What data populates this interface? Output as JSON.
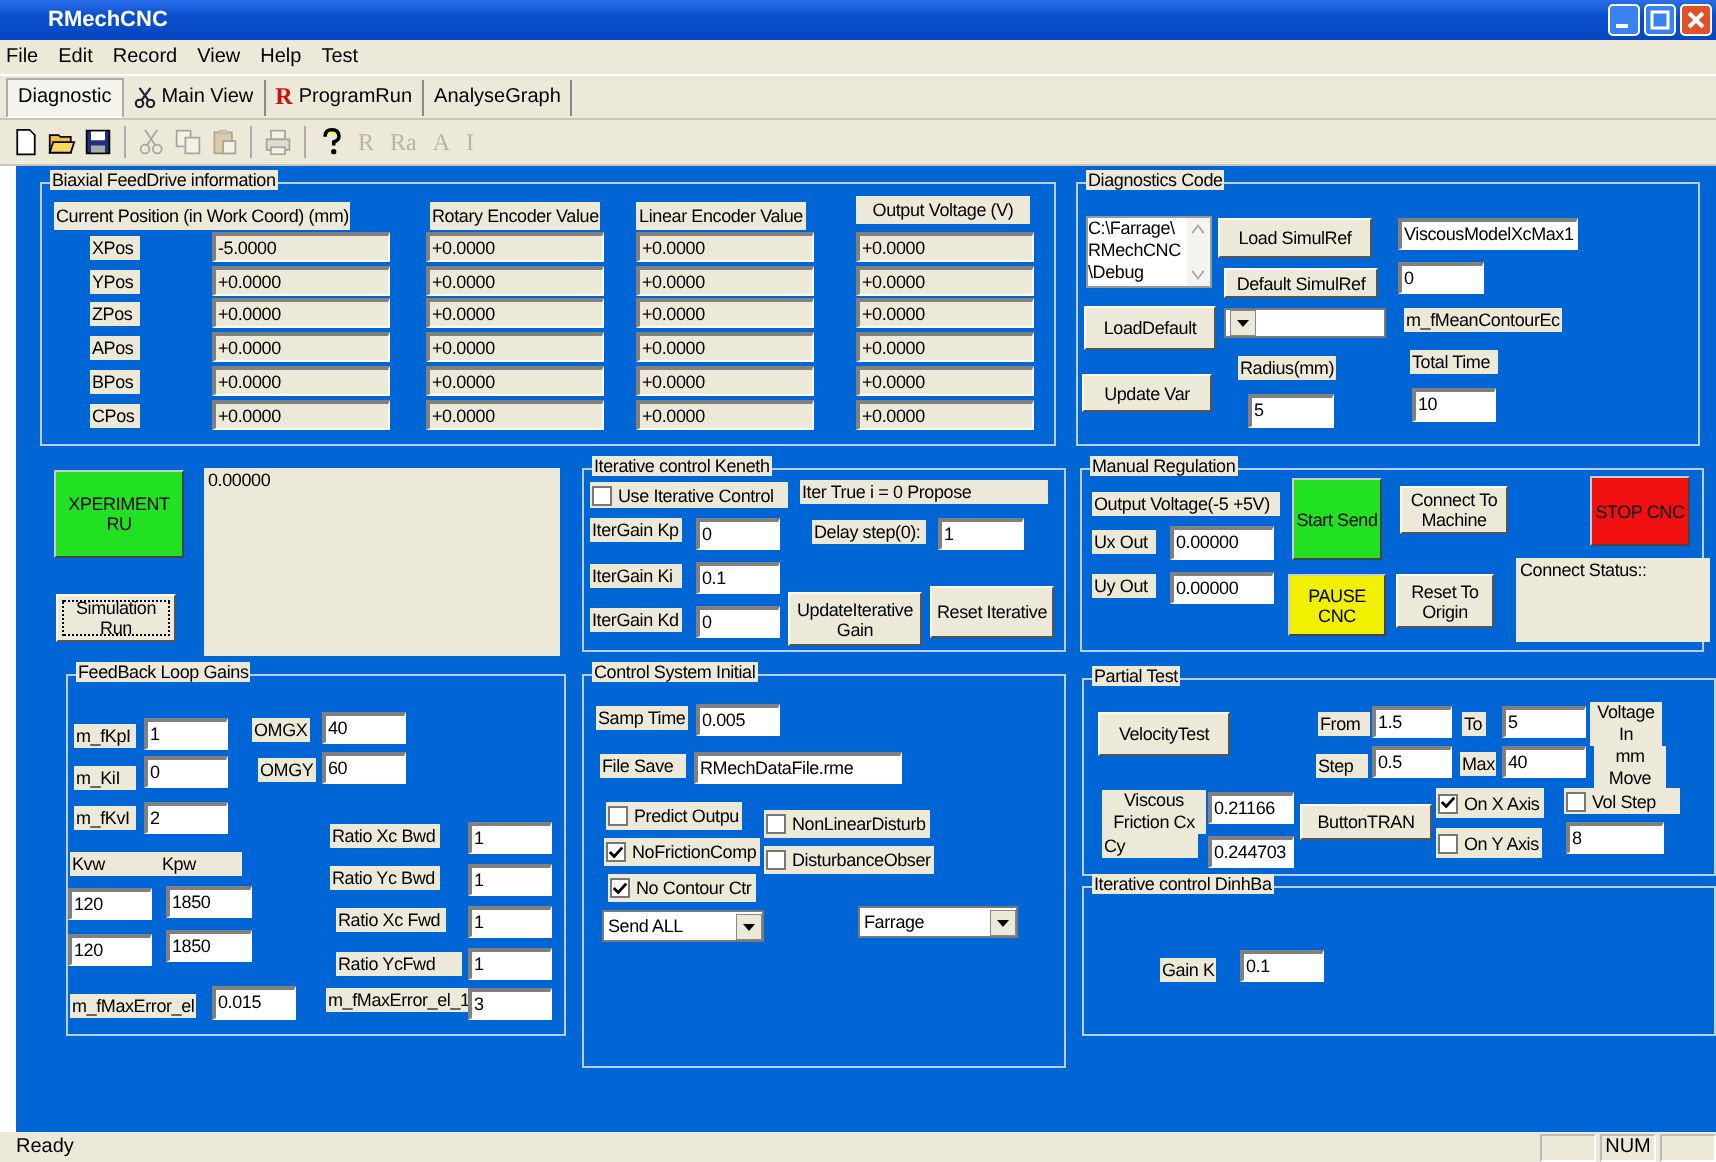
{
  "window": {
    "title": "RMechCNC"
  },
  "menu": [
    "File",
    "Edit",
    "Record",
    "View",
    "Help",
    "Test"
  ],
  "tabs": [
    {
      "label": "Diagnostic",
      "selected": true
    },
    {
      "label": "Main View",
      "selected": false,
      "kind": "scissors"
    },
    {
      "label": "ProgramRun",
      "selected": false,
      "prefix": "R"
    },
    {
      "label": "AnalyseGraph",
      "selected": false
    }
  ],
  "toolbar": [
    {
      "kind": "new",
      "disabled": false
    },
    {
      "kind": "open",
      "disabled": false
    },
    {
      "kind": "save",
      "disabled": false
    },
    {
      "kind": "separator"
    },
    {
      "kind": "cut",
      "disabled": true
    },
    {
      "kind": "copy",
      "disabled": true
    },
    {
      "kind": "paste",
      "disabled": true
    },
    {
      "kind": "separator"
    },
    {
      "kind": "print",
      "disabled": true
    },
    {
      "kind": "separator"
    },
    {
      "kind": "help",
      "disabled": false
    },
    {
      "kind": "text",
      "label": "R",
      "disabled": true
    },
    {
      "kind": "text",
      "label": "Ra",
      "disabled": true
    },
    {
      "kind": "text",
      "label": "A",
      "disabled": true
    },
    {
      "kind": "text",
      "label": "I",
      "disabled": true
    }
  ],
  "feed_drive": {
    "title": "Biaxial FeedDrive information",
    "columns": [
      "Current Position (in Work Coord) (mm)",
      "Rotary Encoder Value",
      "Linear Encoder Value",
      "Output Voltage (V)"
    ],
    "rows": [
      {
        "label": "XPos",
        "values": [
          "-5.0000",
          "+0.0000",
          "+0.0000",
          "+0.0000"
        ]
      },
      {
        "label": "YPos",
        "values": [
          "+0.0000",
          "+0.0000",
          "+0.0000",
          "+0.0000"
        ]
      },
      {
        "label": "ZPos",
        "values": [
          "+0.0000",
          "+0.0000",
          "+0.0000",
          "+0.0000"
        ]
      },
      {
        "label": "APos",
        "values": [
          "+0.0000",
          "+0.0000",
          "+0.0000",
          "+0.0000"
        ]
      },
      {
        "label": "BPos",
        "values": [
          "+0.0000",
          "+0.0000",
          "+0.0000",
          "+0.0000"
        ]
      },
      {
        "label": "CPos",
        "values": [
          "+0.0000",
          "+0.0000",
          "+0.0000",
          "+0.0000"
        ]
      }
    ]
  },
  "groups": [
    {
      "title": "Diagnostics Code",
      "controls": [
        {
          "kind": "listbox",
          "lines": [
            "C:\\Farrage\\",
            "RMechCNC",
            "\\Debug"
          ]
        },
        {
          "kind": "button",
          "text": "Load SimulRef"
        },
        {
          "kind": "field",
          "value": "ViscousModelXcMax1"
        },
        {
          "kind": "button",
          "text": "Default SimulRef"
        },
        {
          "kind": "field",
          "value": "0"
        },
        {
          "kind": "button",
          "text": "LoadDefault"
        },
        {
          "kind": "combo"
        },
        {
          "kind": "label",
          "text": "m_fMeanContourEc"
        },
        {
          "kind": "label",
          "text": "Radius(mm)"
        },
        {
          "kind": "label",
          "text": "Total Time"
        },
        {
          "kind": "button",
          "text": "Update Var"
        },
        {
          "kind": "field",
          "value": "5"
        },
        {
          "kind": "field",
          "value": "10"
        }
      ]
    },
    {
      "title": "Iterative control Keneth",
      "controls": [
        {
          "kind": "checkbox",
          "text": "Use Iterative Control",
          "checked": false
        },
        {
          "kind": "label",
          "text": "Iter True  i = 0   Propose"
        },
        {
          "kind": "label",
          "text": "IterGain Kp"
        },
        {
          "kind": "field",
          "value": "0"
        },
        {
          "kind": "label",
          "text": "Delay step(0):"
        },
        {
          "kind": "field",
          "value": "1"
        },
        {
          "kind": "label",
          "text": "IterGain Ki"
        },
        {
          "kind": "field",
          "value": "0.1"
        },
        {
          "kind": "label",
          "text": "IterGain Kd"
        },
        {
          "kind": "field",
          "value": "0"
        },
        {
          "kind": "button",
          "text": "UpdateIterative Gain"
        },
        {
          "kind": "button",
          "text": "Reset Iterative"
        }
      ]
    },
    {
      "title": "Manual Regulation",
      "controls": [
        {
          "kind": "label",
          "text": "Output Voltage(-5 +5V)"
        },
        {
          "kind": "label",
          "text": "Ux Out"
        },
        {
          "kind": "field",
          "value": "0.00000"
        },
        {
          "kind": "label",
          "text": "Uy Out"
        },
        {
          "kind": "field",
          "value": "0.00000"
        },
        {
          "kind": "button",
          "text": "Start Send",
          "color": "#22e022"
        },
        {
          "kind": "button",
          "text": "PAUSE CNC",
          "color": "#f0f000"
        },
        {
          "kind": "button",
          "text": "Connect To Machine"
        },
        {
          "kind": "button",
          "text": "Reset To Origin"
        },
        {
          "kind": "button",
          "text": "STOP CNC",
          "color": "#f01010"
        },
        {
          "kind": "static",
          "text": "Connect Status::"
        }
      ]
    },
    {
      "title": "FeedBack Loop Gains",
      "controls": [
        {
          "kind": "label",
          "text": "m_fKpI"
        },
        {
          "kind": "field",
          "value": "1"
        },
        {
          "kind": "label",
          "text": "OMGX"
        },
        {
          "kind": "field",
          "value": "40"
        },
        {
          "kind": "label",
          "text": "m_KiI"
        },
        {
          "kind": "field",
          "value": "0"
        },
        {
          "kind": "label",
          "text": "OMGY"
        },
        {
          "kind": "field",
          "value": "60"
        },
        {
          "kind": "label",
          "text": "m_fKvI"
        },
        {
          "kind": "field",
          "value": "2"
        },
        {
          "kind": "label",
          "text": "Ratio Xc Bwd"
        },
        {
          "kind": "field",
          "value": "1"
        },
        {
          "kind": "label",
          "text": "Kvw"
        },
        {
          "kind": "label",
          "text": "Kpw"
        },
        {
          "kind": "field",
          "value": "120"
        },
        {
          "kind": "field",
          "value": "1850"
        },
        {
          "kind": "label",
          "text": "Ratio Yc Bwd"
        },
        {
          "kind": "field",
          "value": "1"
        },
        {
          "kind": "label",
          "text": "Ratio Xc Fwd"
        },
        {
          "kind": "field",
          "value": "1"
        },
        {
          "kind": "field",
          "value": "120"
        },
        {
          "kind": "field",
          "value": "1850"
        },
        {
          "kind": "label",
          "text": "Ratio YcFwd"
        },
        {
          "kind": "field",
          "value": "1"
        },
        {
          "kind": "label",
          "text": "m_fMaxError_el"
        },
        {
          "kind": "field",
          "value": "0.015"
        },
        {
          "kind": "label",
          "text": "m_fMaxError_el_1"
        },
        {
          "kind": "field",
          "value": "3"
        }
      ]
    },
    {
      "title": "Control System Initial",
      "controls": [
        {
          "kind": "label",
          "text": "Samp Time"
        },
        {
          "kind": "field",
          "value": "0.005"
        },
        {
          "kind": "label",
          "text": "File Save"
        },
        {
          "kind": "field",
          "value": "RMechDataFile.rme"
        },
        {
          "kind": "checkbox",
          "text": "Predict Outpu",
          "checked": false
        },
        {
          "kind": "checkbox",
          "text": "NoFrictionComp",
          "checked": true
        },
        {
          "kind": "checkbox",
          "text": "No Contour Ctr",
          "checked": true
        },
        {
          "kind": "checkbox",
          "text": "NonLinearDisturb",
          "checked": false
        },
        {
          "kind": "checkbox",
          "text": "DisturbanceObser",
          "checked": false
        },
        {
          "kind": "combo",
          "value": "Send ALL"
        },
        {
          "kind": "combo",
          "value": "Farrage"
        }
      ]
    },
    {
      "title": "Partial Test",
      "controls": [
        {
          "kind": "button",
          "text": "VelocityTest"
        },
        {
          "kind": "label",
          "text": "From"
        },
        {
          "kind": "field",
          "value": "1.5"
        },
        {
          "kind": "label",
          "text": "To"
        },
        {
          "kind": "field",
          "value": "5"
        },
        {
          "kind": "label",
          "text": "Voltage In"
        },
        {
          "kind": "label",
          "text": "Step"
        },
        {
          "kind": "field",
          "value": "0.5"
        },
        {
          "kind": "label",
          "text": "Max"
        },
        {
          "kind": "field",
          "value": "40"
        },
        {
          "kind": "label",
          "text": "mm Move"
        },
        {
          "kind": "label",
          "text": "Viscous Friction Cx"
        },
        {
          "kind": "field",
          "value": "0.21166"
        },
        {
          "kind": "label",
          "text": "Cy"
        },
        {
          "kind": "field",
          "value": "0.244703"
        },
        {
          "kind": "button",
          "text": "ButtonTRAN"
        },
        {
          "kind": "checkbox",
          "text": "On X Axis",
          "checked": true
        },
        {
          "kind": "checkbox",
          "text": "On Y Axis",
          "checked": false
        },
        {
          "kind": "checkbox",
          "text": "Vol Step",
          "checked": false
        },
        {
          "kind": "field",
          "value": "8"
        }
      ]
    },
    {
      "title": "Iterative control DinhBa",
      "controls": [
        {
          "kind": "label",
          "text": "Gain K"
        },
        {
          "kind": "field",
          "value": "0.1"
        }
      ]
    }
  ],
  "controls": [
    {
      "kind": "button",
      "text": "XPERIMENT RU",
      "color": "#22e022"
    },
    {
      "kind": "button",
      "text": "Simulation Run",
      "focused": true
    },
    {
      "kind": "static",
      "text": "0.00000"
    }
  ],
  "status_bar": {
    "text": "Ready",
    "indicators": [
      "NUM"
    ]
  }
}
